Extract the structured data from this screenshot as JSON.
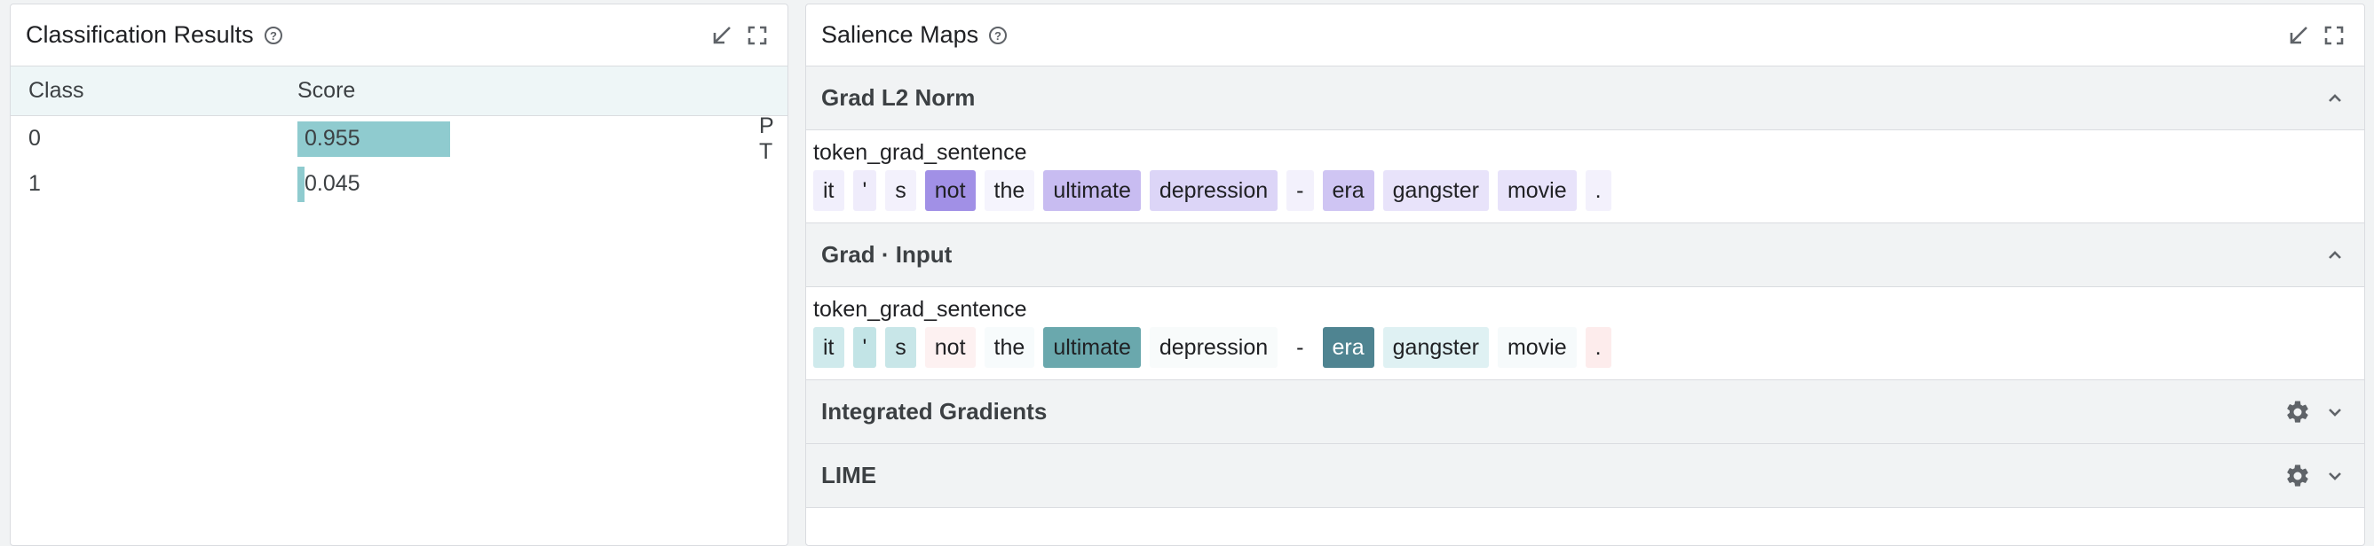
{
  "classification": {
    "title": "Classification Results",
    "columns": [
      "Class",
      "Score"
    ],
    "rows": [
      {
        "class": "0",
        "score": "0.955",
        "score_value": 0.955,
        "marks": "P T"
      },
      {
        "class": "1",
        "score": "0.045",
        "score_value": 0.045,
        "marks": ""
      }
    ],
    "bar_color": "#8fcbcf"
  },
  "salience": {
    "title": "Salience Maps",
    "sections": [
      {
        "name": "Grad L2 Norm",
        "expanded": true,
        "field": "token_grad_sentence",
        "tokens": [
          {
            "text": "it",
            "bg": "#f1effc",
            "fg": "#202124"
          },
          {
            "text": "'",
            "bg": "#efecfb",
            "fg": "#202124"
          },
          {
            "text": "s",
            "bg": "#f3f1fc",
            "fg": "#202124"
          },
          {
            "text": "not",
            "bg": "#a190e6",
            "fg": "#202124"
          },
          {
            "text": "the",
            "bg": "#f5f4fd",
            "fg": "#202124"
          },
          {
            "text": "ultimate",
            "bg": "#c8bcf1",
            "fg": "#202124"
          },
          {
            "text": "depression",
            "bg": "#dcd5f7",
            "fg": "#202124"
          },
          {
            "text": "-",
            "bg": "#f3f1fc",
            "fg": "#202124"
          },
          {
            "text": "era",
            "bg": "#cfc5f3",
            "fg": "#202124"
          },
          {
            "text": "gangster",
            "bg": "#e8e3fa",
            "fg": "#202124"
          },
          {
            "text": "movie",
            "bg": "#e8e3fa",
            "fg": "#202124"
          },
          {
            "text": ".",
            "bg": "#f3f1fc",
            "fg": "#202124"
          }
        ]
      },
      {
        "name": "Grad · Input",
        "expanded": true,
        "field": "token_grad_sentence",
        "tokens": [
          {
            "text": "it",
            "bg": "#cfeaec",
            "fg": "#202124"
          },
          {
            "text": "'",
            "bg": "#c2e4e6",
            "fg": "#202124"
          },
          {
            "text": "s",
            "bg": "#c8e6e8",
            "fg": "#202124"
          },
          {
            "text": "not",
            "bg": "#fdf1f1",
            "fg": "#202124"
          },
          {
            "text": "the",
            "bg": "#f7fbfc",
            "fg": "#202124"
          },
          {
            "text": "ultimate",
            "bg": "#6aa8ad",
            "fg": "#202124"
          },
          {
            "text": "depression",
            "bg": "#f8fbfb",
            "fg": "#202124"
          },
          {
            "text": "-",
            "bg": "#ffffff",
            "fg": "#202124"
          },
          {
            "text": "era",
            "bg": "#4f8491",
            "fg": "#ffffff"
          },
          {
            "text": "gangster",
            "bg": "#dff1f3",
            "fg": "#202124"
          },
          {
            "text": "movie",
            "bg": "#f6fafb",
            "fg": "#202124"
          },
          {
            "text": ".",
            "bg": "#fdecec",
            "fg": "#202124"
          }
        ]
      },
      {
        "name": "Integrated Gradients",
        "expanded": false
      },
      {
        "name": "LIME",
        "expanded": false
      }
    ]
  }
}
